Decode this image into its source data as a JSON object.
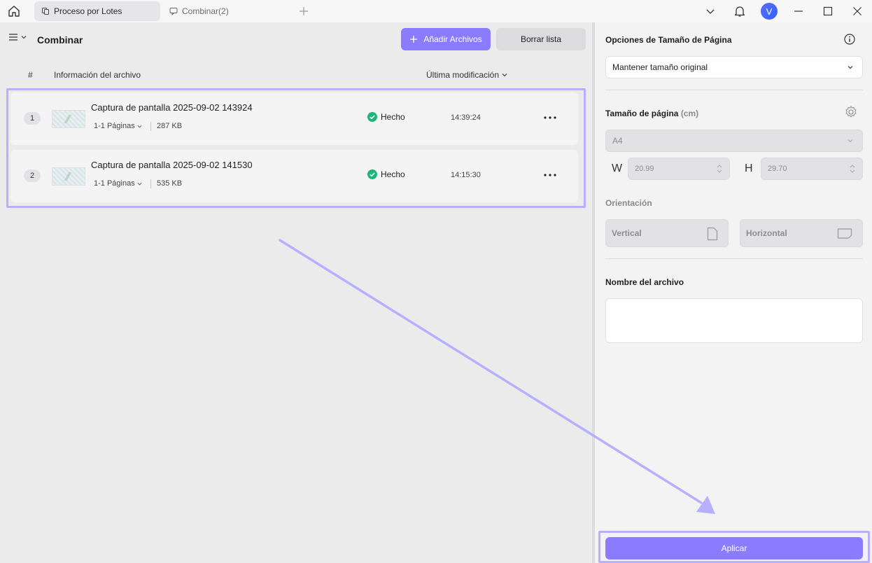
{
  "titlebar": {
    "tabs": [
      {
        "label": "Proceso por Lotes",
        "icon": "batch-icon",
        "active": true
      },
      {
        "label": "Combinar(2)",
        "icon": "chat-bubble-icon",
        "active": false
      }
    ],
    "avatar_letter": "V"
  },
  "toolbar": {
    "title": "Combinar",
    "add_label": "Añadir Archivos",
    "clear_label": "Borrar lista"
  },
  "columns": {
    "num": "#",
    "info": "Información del archivo",
    "modified": "Última modificación"
  },
  "files": [
    {
      "index": "1",
      "name": "Captura de pantalla 2025-09-02 143924",
      "pages": "1-1 Páginas",
      "size": "287 KB",
      "status": "Hecho",
      "time": "14:39:24"
    },
    {
      "index": "2",
      "name": "Captura de pantalla 2025-09-02 141530",
      "pages": "1-1 Páginas",
      "size": "535 KB",
      "status": "Hecho",
      "time": "14:15:30"
    }
  ],
  "settings": {
    "page_size_options_label": "Opciones de Tamaño de Página",
    "page_size_option_value": "Mantener tamaño original",
    "page_size_label": "Tamaño de página",
    "page_size_unit": "(cm)",
    "paper_value": "A4",
    "w_label": "W",
    "w_value": "20.99",
    "h_label": "H",
    "h_value": "29.70",
    "orientation_label": "Orientación",
    "vertical_label": "Vertical",
    "horizontal_label": "Horizontal",
    "filename_label": "Nombre del archivo",
    "filename_value": "",
    "apply_label": "Aplicar"
  },
  "colors": {
    "accent": "#8b7cff",
    "highlight": "#b8b0ff",
    "success": "#1fb57a"
  }
}
